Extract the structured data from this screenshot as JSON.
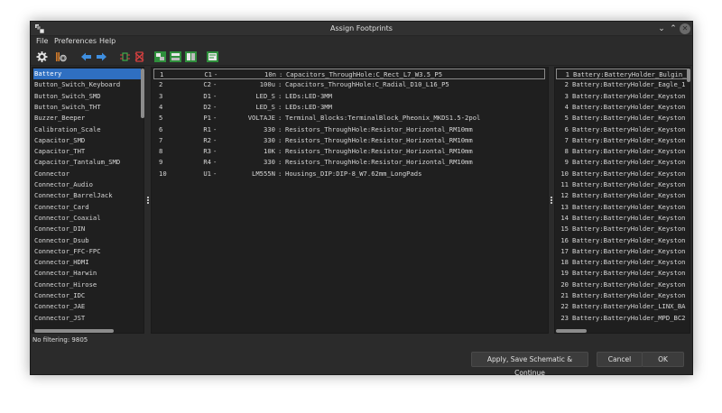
{
  "window": {
    "title": "Assign Footprints",
    "controls": {
      "minimize": "⌄",
      "maximize": "⌃",
      "close": "✕"
    }
  },
  "menu": [
    "File",
    "Preferences",
    "Help"
  ],
  "toolbar": {
    "icons": [
      "settings-icon",
      "library-icon",
      "arrow-left-icon",
      "arrow-right-icon",
      "auto-assign-icon",
      "delete-icon",
      "filter-keywords-icon",
      "filter-pincount-icon",
      "filter-library-icon",
      "filter-text-icon"
    ]
  },
  "libraries": [
    "Battery",
    "Button_Switch_Keyboard",
    "Button_Switch_SMD",
    "Button_Switch_THT",
    "Buzzer_Beeper",
    "Calibration_Scale",
    "Capacitor_SMD",
    "Capacitor_THT",
    "Capacitor_Tantalum_SMD",
    "Connector",
    "Connector_Audio",
    "Connector_BarrelJack",
    "Connector_Card",
    "Connector_Coaxial",
    "Connector_DIN",
    "Connector_Dsub",
    "Connector_FFC-FPC",
    "Connector_HDMI",
    "Connector_Harwin",
    "Connector_Hirose",
    "Connector_IDC",
    "Connector_JAE",
    "Connector_JST"
  ],
  "selected_library": "Battery",
  "components": [
    {
      "num": "1",
      "ref": "C1",
      "dash": "-",
      "value": "10n",
      "sep": ":",
      "footprint": "Capacitors_ThroughHole:C_Rect_L7_W3.5_P5"
    },
    {
      "num": "2",
      "ref": "C2",
      "dash": "-",
      "value": "100u",
      "sep": ":",
      "footprint": "Capacitors_ThroughHole:C_Radial_D10_L16_P5"
    },
    {
      "num": "3",
      "ref": "D1",
      "dash": "-",
      "value": "LED_S",
      "sep": ":",
      "footprint": "LEDs:LED-3MM"
    },
    {
      "num": "4",
      "ref": "D2",
      "dash": "-",
      "value": "LED_S",
      "sep": ":",
      "footprint": "LEDs:LED-3MM"
    },
    {
      "num": "5",
      "ref": "P1",
      "dash": "-",
      "value": "VOLTAJE",
      "sep": ":",
      "footprint": "Terminal_Blocks:TerminalBlock_Pheonix_MKDS1.5-2pol"
    },
    {
      "num": "6",
      "ref": "R1",
      "dash": "-",
      "value": "330",
      "sep": ":",
      "footprint": "Resistors_ThroughHole:Resistor_Horizontal_RM10mm"
    },
    {
      "num": "7",
      "ref": "R2",
      "dash": "-",
      "value": "330",
      "sep": ":",
      "footprint": "Resistors_ThroughHole:Resistor_Horizontal_RM10mm"
    },
    {
      "num": "8",
      "ref": "R3",
      "dash": "-",
      "value": "10K",
      "sep": ":",
      "footprint": "Resistors_ThroughHole:Resistor_Horizontal_RM10mm"
    },
    {
      "num": "9",
      "ref": "R4",
      "dash": "-",
      "value": "330",
      "sep": ":",
      "footprint": "Resistors_ThroughHole:Resistor_Horizontal_RM10mm"
    },
    {
      "num": "10",
      "ref": "U1",
      "dash": "-",
      "value": "LM555N",
      "sep": ":",
      "footprint": "Housings_DIP:DIP-8_W7.62mm_LongPads"
    }
  ],
  "footprints": [
    {
      "num": "1",
      "name": "Battery:BatteryHolder_Bulgin_"
    },
    {
      "num": "2",
      "name": "Battery:BatteryHolder_Eagle_1"
    },
    {
      "num": "3",
      "name": "Battery:BatteryHolder_Keyston"
    },
    {
      "num": "4",
      "name": "Battery:BatteryHolder_Keyston"
    },
    {
      "num": "5",
      "name": "Battery:BatteryHolder_Keyston"
    },
    {
      "num": "6",
      "name": "Battery:BatteryHolder_Keyston"
    },
    {
      "num": "7",
      "name": "Battery:BatteryHolder_Keyston"
    },
    {
      "num": "8",
      "name": "Battery:BatteryHolder_Keyston"
    },
    {
      "num": "9",
      "name": "Battery:BatteryHolder_Keyston"
    },
    {
      "num": "10",
      "name": "Battery:BatteryHolder_Keyston"
    },
    {
      "num": "11",
      "name": "Battery:BatteryHolder_Keyston"
    },
    {
      "num": "12",
      "name": "Battery:BatteryHolder_Keyston"
    },
    {
      "num": "13",
      "name": "Battery:BatteryHolder_Keyston"
    },
    {
      "num": "14",
      "name": "Battery:BatteryHolder_Keyston"
    },
    {
      "num": "15",
      "name": "Battery:BatteryHolder_Keyston"
    },
    {
      "num": "16",
      "name": "Battery:BatteryHolder_Keyston"
    },
    {
      "num": "17",
      "name": "Battery:BatteryHolder_Keyston"
    },
    {
      "num": "18",
      "name": "Battery:BatteryHolder_Keyston"
    },
    {
      "num": "19",
      "name": "Battery:BatteryHolder_Keyston"
    },
    {
      "num": "20",
      "name": "Battery:BatteryHolder_Keyston"
    },
    {
      "num": "21",
      "name": "Battery:BatteryHolder_Keyston"
    },
    {
      "num": "22",
      "name": "Battery:BatteryHolder_LINX_BA"
    },
    {
      "num": "23",
      "name": "Battery:BatteryHolder_MPD_BC2"
    }
  ],
  "status": "No filtering: 9805",
  "buttons": {
    "apply": "Apply, Save Schematic & Continue",
    "cancel": "Cancel",
    "ok": "OK"
  },
  "colors": {
    "selection": "#2f6fc1",
    "background": "#2b2b2b",
    "panel": "#1f1f1f"
  }
}
